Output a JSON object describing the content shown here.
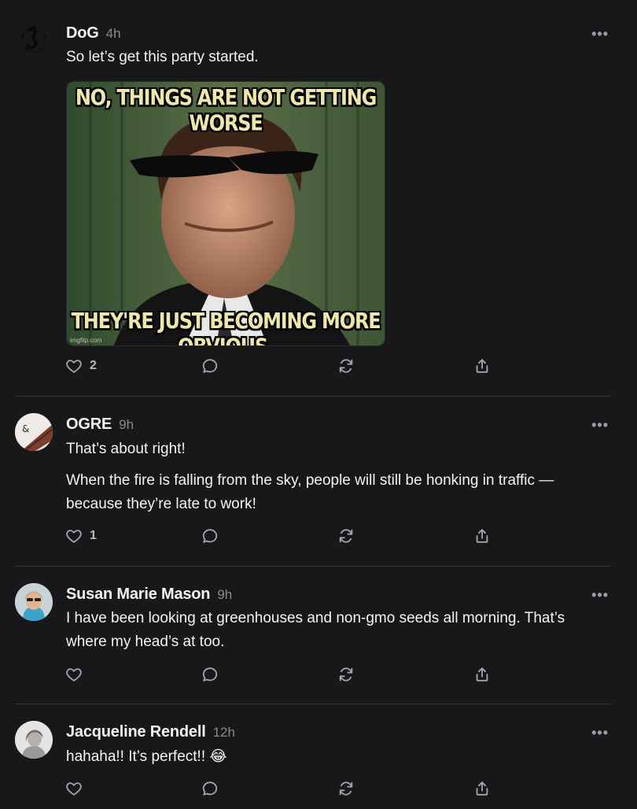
{
  "posts": [
    {
      "name": "DoG",
      "time": "4h",
      "more": "•••",
      "text": "So let’s get this party started.",
      "image": {
        "top_text": "NO, THINGS ARE NOT GETTING WORSE",
        "bottom_text": "THEY'RE JUST BECOMING MORE OBVIOUS.",
        "watermark": "imgflip.com"
      },
      "likes": "2"
    },
    {
      "name": "OGRE",
      "time": "9h",
      "more": "•••",
      "text": "That’s about right!",
      "text2": "When the fire is falling from the sky, people will still be honking in traffic — because they’re late to work!",
      "likes": "1"
    },
    {
      "name": "Susan Marie Mason",
      "time": "9h",
      "more": "•••",
      "text": "I have been looking at greenhouses and non-gmo seeds all morning. That’s where my head’s at too.",
      "likes": ""
    },
    {
      "name": "Jacqueline Rendell",
      "time": "12h",
      "more": "•••",
      "text": "hahaha!! It’s perfect!! 😂",
      "likes": ""
    }
  ],
  "icons": [
    "heart-icon",
    "comment-icon",
    "restack-icon",
    "share-icon",
    "more-icon"
  ],
  "colors": {
    "background": "#18181b",
    "text": "#f3f3f3",
    "muted": "#8a8a8f",
    "divider": "#34343a"
  }
}
